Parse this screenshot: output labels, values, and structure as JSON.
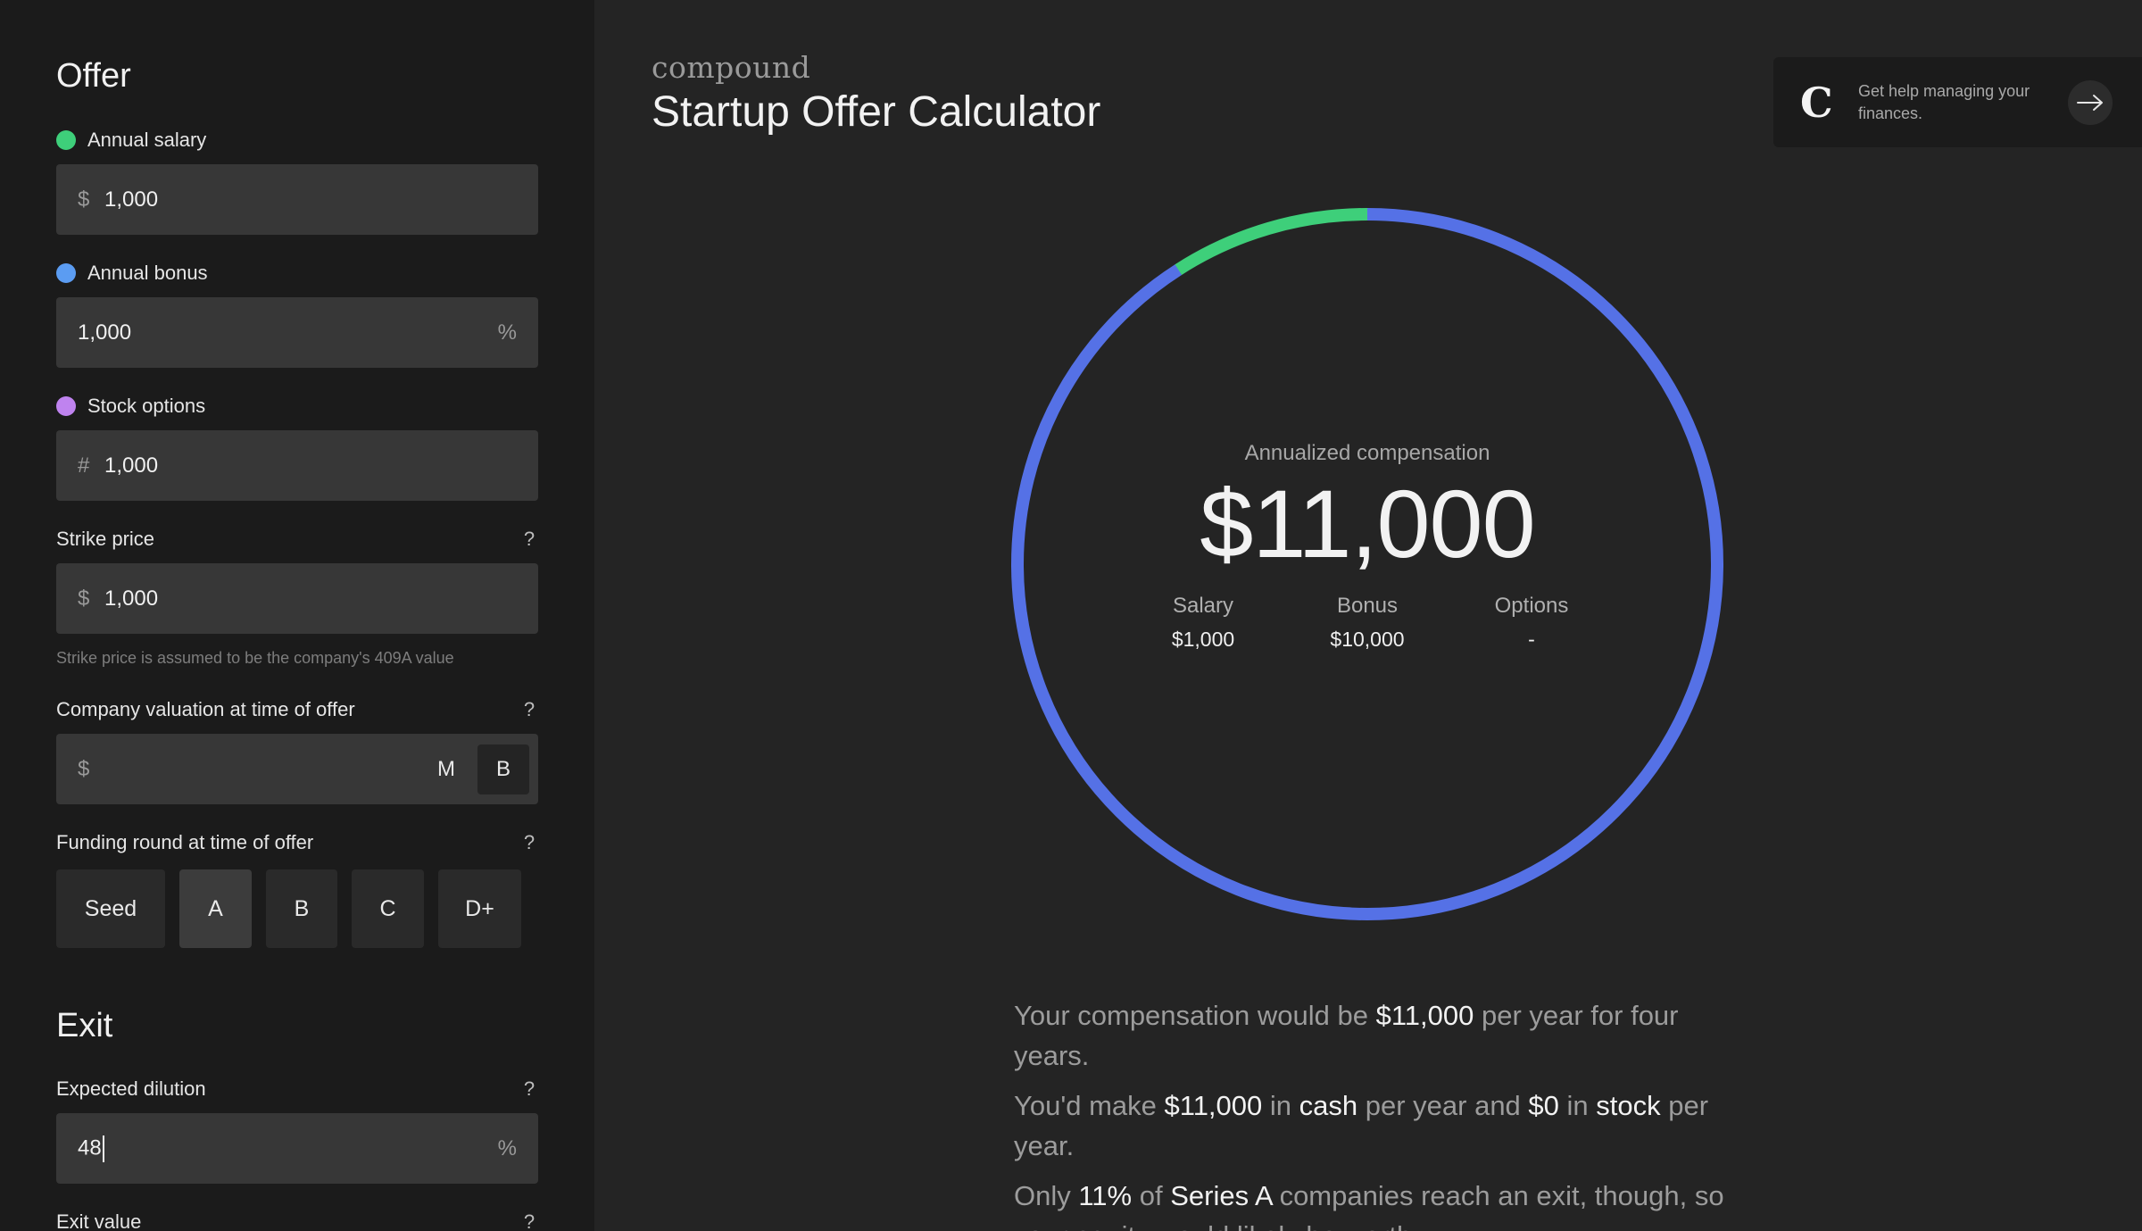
{
  "sidebar": {
    "offer_title": "Offer",
    "salary": {
      "label": "Annual salary",
      "prefix": "$",
      "value": "1,000",
      "dot_color": "#3ecf7a"
    },
    "bonus": {
      "label": "Annual bonus",
      "value": "1,000",
      "suffix": "%",
      "dot_color": "#5b9cf2"
    },
    "options": {
      "label": "Stock options",
      "prefix": "#",
      "value": "1,000",
      "dot_color": "#bf83ef"
    },
    "strike": {
      "label": "Strike price",
      "help": "?",
      "prefix": "$",
      "value": "1,000",
      "hint": "Strike price is assumed to be the company's 409A value"
    },
    "valuation": {
      "label": "Company valuation at time of offer",
      "help": "?",
      "prefix": "$",
      "value": "",
      "units": [
        "M",
        "B"
      ],
      "selected_unit": "B"
    },
    "funding": {
      "label": "Funding round at time of offer",
      "help": "?",
      "rounds": [
        "Seed",
        "A",
        "B",
        "C",
        "D+"
      ],
      "selected": "A"
    },
    "exit_title": "Exit",
    "dilution": {
      "label": "Expected dilution",
      "help": "?",
      "value": "48",
      "suffix": "%"
    },
    "exit_value": {
      "label": "Exit value",
      "help": "?"
    }
  },
  "header": {
    "brand": "compound",
    "title": "Startup Offer Calculator"
  },
  "help_card": {
    "logo": "C",
    "text": "Get help managing your finances.",
    "icon": "arrow-right-icon"
  },
  "summary_card": {
    "label": "Annualized compensation",
    "total": "$11,000",
    "breakdown": [
      {
        "label": "Salary",
        "value": "$1,000"
      },
      {
        "label": "Bonus",
        "value": "$10,000"
      },
      {
        "label": "Options",
        "value": "-"
      }
    ]
  },
  "donut": {
    "segments": [
      {
        "name": "Salary",
        "value": 1000,
        "color": "#3ecf7a"
      },
      {
        "name": "Bonus",
        "value": 10000,
        "color": "#5571e6"
      }
    ]
  },
  "summary": {
    "p1": [
      "Your compensation would be ",
      "$11,000",
      " per year for four years."
    ],
    "p2": [
      "You'd make ",
      "$11,000",
      " in ",
      "cash",
      " per year and ",
      "$0",
      " in ",
      "stock",
      " per year."
    ],
    "p3": [
      "Only ",
      "11%",
      " of ",
      "Series A",
      " companies reach an exit, though, so your equity would likely be worth ..."
    ]
  },
  "colors": {
    "background": "#242424",
    "sidebar": "#1b1b1b",
    "input": "#373737",
    "salary": "#3ecf7a",
    "bonus": "#5571e6",
    "options": "#bf83ef"
  }
}
